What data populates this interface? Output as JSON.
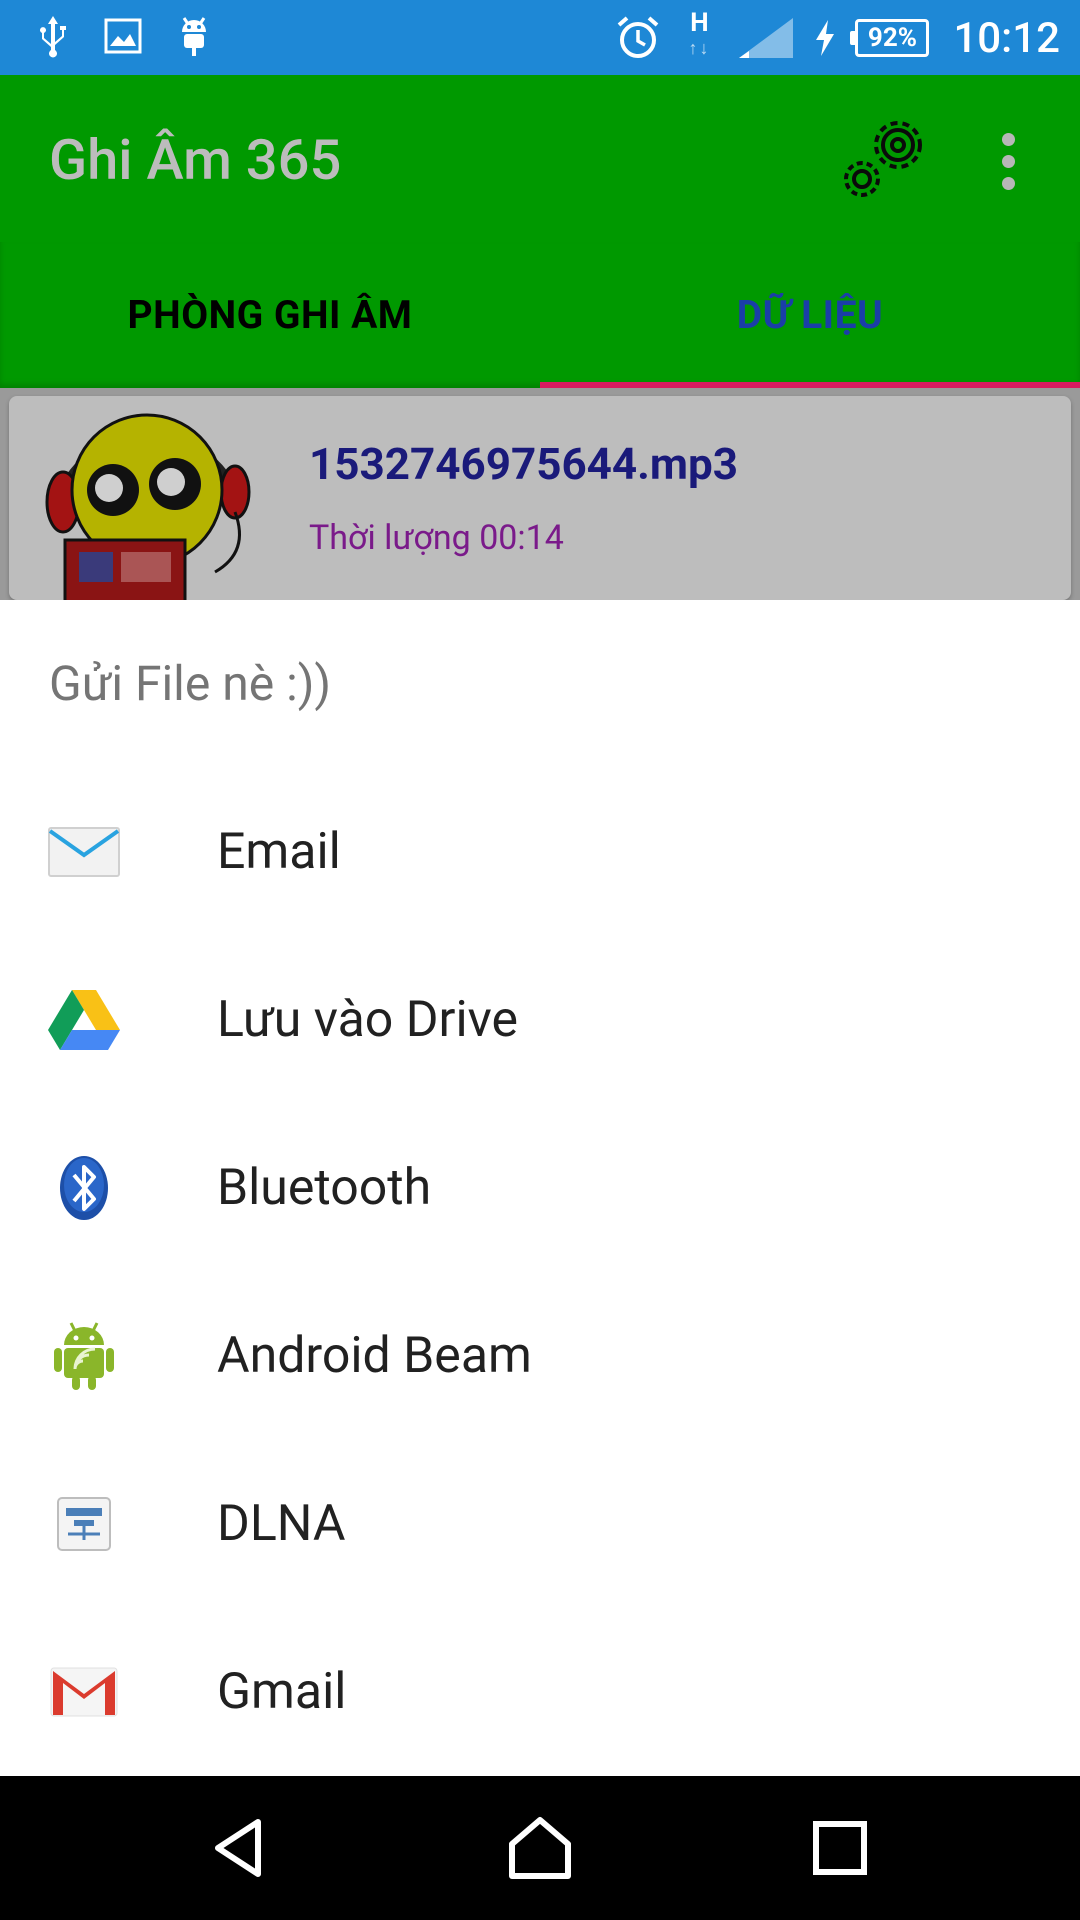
{
  "status_bar": {
    "time": "10:12",
    "battery_percent": "92%",
    "network_label": "H",
    "icons": [
      "usb-icon",
      "image-icon",
      "android-debug-icon",
      "alarm-icon",
      "signal-icon",
      "charging-icon",
      "battery-icon"
    ]
  },
  "app_bar": {
    "title": "Ghi Âm 365",
    "title_color": "#bcbcbc",
    "background": "#009900"
  },
  "tabs": [
    {
      "label": "PHÒNG GHI ÂM",
      "selected": false
    },
    {
      "label": "DỮ LIỆU",
      "selected": true
    }
  ],
  "colors": {
    "status_bar": "#1E88D6",
    "tab_indicator": "#d81b60",
    "selected_tab_text": "#1a3ea8"
  },
  "recording_list": [
    {
      "file_name": "1532746975644.mp3",
      "duration": "Thời lượng 00:14"
    }
  ],
  "share_sheet": {
    "title": "Gửi File nè :))",
    "items": [
      {
        "label": "Email",
        "icon": "email-icon"
      },
      {
        "label": "Lưu vào Drive",
        "icon": "drive-icon"
      },
      {
        "label": "Bluetooth",
        "icon": "bluetooth-icon"
      },
      {
        "label": "Android Beam",
        "icon": "android-beam-icon"
      },
      {
        "label": "DLNA",
        "icon": "dlna-icon"
      },
      {
        "label": "Gmail",
        "icon": "gmail-icon"
      }
    ]
  },
  "nav_bar": {
    "buttons": [
      "back-icon",
      "home-icon",
      "recents-icon"
    ]
  }
}
